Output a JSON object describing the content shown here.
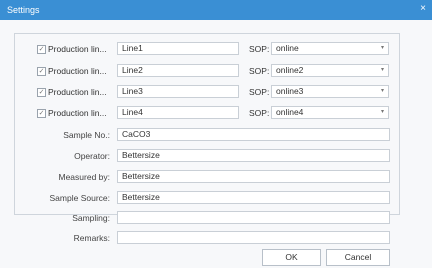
{
  "window": {
    "title": "Settings",
    "close_glyph": "×"
  },
  "production_lines": [
    {
      "label": "Production lin...",
      "value": "Line1",
      "sop_label": "SOP:",
      "sop_value": "online"
    },
    {
      "label": "Production lin...",
      "value": "Line2",
      "sop_label": "SOP:",
      "sop_value": "online2"
    },
    {
      "label": "Production lin...",
      "value": "Line3",
      "sop_label": "SOP:",
      "sop_value": "online3"
    },
    {
      "label": "Production lin...",
      "value": "Line4",
      "sop_label": "SOP:",
      "sop_value": "online4"
    }
  ],
  "checkbox_glyph": "✓",
  "caret_glyph": "▾",
  "fields": [
    {
      "label": "Sample No.:",
      "value": "CaCO3"
    },
    {
      "label": "Operator:",
      "value": "Bettersize"
    },
    {
      "label": "Measured by:",
      "value": "Bettersize"
    },
    {
      "label": "Sample Source:",
      "value": "Bettersize"
    },
    {
      "label": "Sampling:",
      "value": ""
    },
    {
      "label": "Remarks:",
      "value": ""
    }
  ],
  "buttons": {
    "ok": "OK",
    "cancel": "Cancel"
  },
  "colors": {
    "titlebar": "#3a8fd4"
  }
}
